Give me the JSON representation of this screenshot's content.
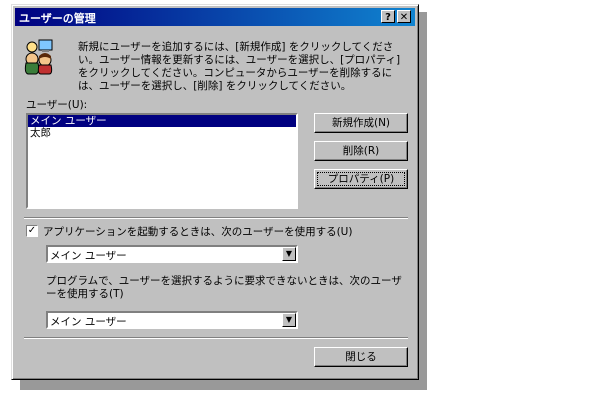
{
  "window": {
    "title": "ユーザーの管理",
    "help_button": "?",
    "close_button": "✕"
  },
  "description": "新規にユーザーを追加するには、[新規作成] をクリックしてください。ユーザー情報を更新するには、ユーザーを選択し、[プロパティ] をクリックしてください。コンピュータからユーザーを削除するには、ユーザーを選択し、[削除] をクリックしてください。",
  "users": {
    "label": "ユーザー(U):",
    "items": [
      {
        "name": "メイン ユーザー",
        "selected": true
      },
      {
        "name": "太郎",
        "selected": false
      }
    ]
  },
  "buttons": {
    "new": "新規作成(N)",
    "delete": "削除(R)",
    "properties": "プロパティ(P)",
    "close": "閉じる"
  },
  "startup": {
    "checkbox_label": "アプリケーションを起動するときは、次のユーザーを使用する(U)",
    "checked": true,
    "selected_user": "メイン ユーザー"
  },
  "program": {
    "label": "プログラムで、ユーザーを選択するように要求できないときは、次のユーザーを使用する(T)",
    "selected_user": "メイン ユーザー"
  },
  "colors": {
    "title_start": "#000080",
    "title_end": "#1084d0",
    "face": "#c0c0c0",
    "selection": "#000080"
  }
}
